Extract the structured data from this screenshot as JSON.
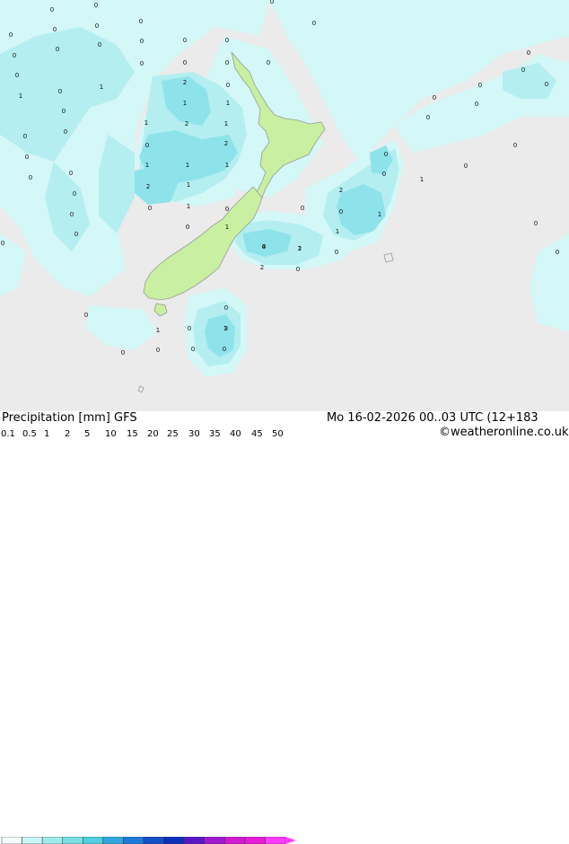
{
  "header": {
    "title": "Precipitation [mm] GFS",
    "datetime": "Mo 16-02-2026 00..03 UTC (12+183",
    "credit": "©weatheronline.co.uk"
  },
  "colorbar": {
    "ticks": [
      "0.1",
      "0.5",
      "1",
      "2",
      "5",
      "10",
      "15",
      "20",
      "25",
      "30",
      "35",
      "40",
      "45",
      "50"
    ],
    "colors": [
      "#f5fcfc",
      "#c8f5f5",
      "#a0ecec",
      "#78e0e4",
      "#50cfe0",
      "#2fa7dc",
      "#1e7cd8",
      "#1450c8",
      "#0c30b8",
      "#5a18c8",
      "#a01ad0",
      "#d21ad0",
      "#e81ad8",
      "#ff3aff"
    ]
  },
  "map": {
    "values": [
      {
        "text": "0"
      },
      {
        "text": "0"
      },
      {
        "text": "0"
      },
      {
        "text": "0"
      },
      {
        "text": "0"
      },
      {
        "text": "0"
      },
      {
        "text": "0"
      },
      {
        "text": "0"
      },
      {
        "text": "0"
      },
      {
        "text": "0"
      },
      {
        "text": "0"
      },
      {
        "text": "0"
      },
      {
        "text": "0"
      },
      {
        "text": "0"
      },
      {
        "text": "0"
      },
      {
        "text": "1"
      },
      {
        "text": "0"
      },
      {
        "text": "2"
      },
      {
        "text": "0"
      },
      {
        "text": "0"
      },
      {
        "text": "0"
      },
      {
        "text": "1"
      },
      {
        "text": "1"
      },
      {
        "text": "0"
      },
      {
        "text": "0"
      },
      {
        "text": "2"
      },
      {
        "text": "1"
      },
      {
        "text": "0"
      },
      {
        "text": "0"
      },
      {
        "text": "1"
      },
      {
        "text": "1"
      },
      {
        "text": "2"
      },
      {
        "text": "0"
      },
      {
        "text": "0"
      },
      {
        "text": "0"
      },
      {
        "text": "1"
      },
      {
        "text": "1"
      },
      {
        "text": "1"
      },
      {
        "text": "0"
      },
      {
        "text": "0"
      },
      {
        "text": "2"
      },
      {
        "text": "1"
      },
      {
        "text": "0"
      },
      {
        "text": "0"
      },
      {
        "text": "1"
      },
      {
        "text": "1"
      },
      {
        "text": "0"
      },
      {
        "text": "0"
      },
      {
        "text": "0"
      },
      {
        "text": "0"
      },
      {
        "text": "1"
      },
      {
        "text": "0"
      },
      {
        "text": "2"
      },
      {
        "text": "0"
      },
      {
        "text": "0"
      },
      {
        "text": "1"
      },
      {
        "text": "0"
      },
      {
        "text": "1"
      },
      {
        "text": "2"
      },
      {
        "text": "0"
      },
      {
        "text": "4"
      },
      {
        "text": "2"
      },
      {
        "text": "1"
      },
      {
        "text": "0"
      },
      {
        "text": "0"
      },
      {
        "text": "0"
      },
      {
        "text": "0"
      },
      {
        "text": "0"
      },
      {
        "text": "1"
      },
      {
        "text": "0"
      },
      {
        "text": "3"
      },
      {
        "text": "0"
      },
      {
        "text": "0"
      },
      {
        "text": "1"
      },
      {
        "text": "0"
      },
      {
        "text": "0"
      },
      {
        "text": "0"
      },
      {
        "text": "0"
      },
      {
        "text": "0"
      },
      {
        "text": "0"
      },
      {
        "text": "0"
      },
      {
        "text": "0"
      },
      {
        "text": "0"
      },
      {
        "text": "0"
      },
      {
        "text": "0"
      },
      {
        "text": "0"
      },
      {
        "text": "0"
      }
    ]
  }
}
